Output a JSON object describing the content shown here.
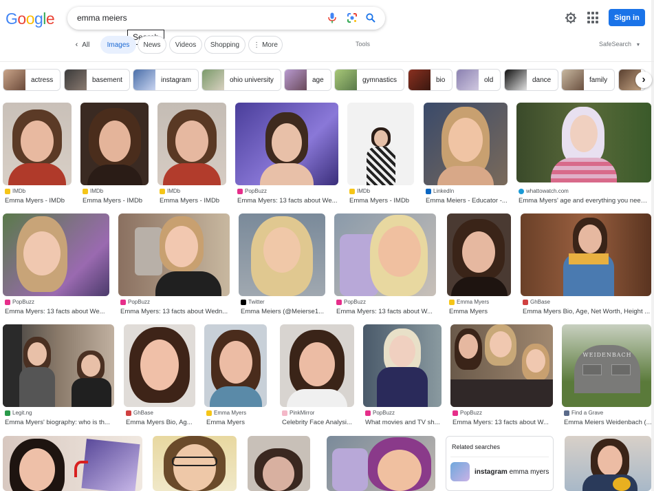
{
  "search": {
    "query": "emma meiers",
    "tooltip": "Search"
  },
  "header": {
    "logo_letters": [
      "G",
      "o",
      "o",
      "g",
      "l",
      "e"
    ],
    "logo_colors": [
      "#4285f4",
      "#ea4335",
      "#fbbc05",
      "#4285f4",
      "#34a853",
      "#ea4335"
    ],
    "sign_in": "Sign in"
  },
  "tabs": {
    "all": "All",
    "images": "Images",
    "news": "News",
    "videos": "Videos",
    "shopping": "Shopping",
    "more": "More",
    "tools": "Tools",
    "safesearch": "SafeSearch"
  },
  "chips": [
    "actress",
    "basement",
    "instagram",
    "ohio university",
    "age",
    "gymnastics",
    "bio",
    "old",
    "dance",
    "family"
  ],
  "results": [
    {
      "source": "IMDb",
      "title": "Emma Myers - IMDb"
    },
    {
      "source": "IMDb",
      "title": "Emma Myers - IMDb"
    },
    {
      "source": "IMDb",
      "title": "Emma Myers - IMDb"
    },
    {
      "source": "PopBuzz",
      "title": "Emma Myers: 13 facts about We..."
    },
    {
      "source": "IMDb",
      "title": "Emma Myers - IMDb"
    },
    {
      "source": "LinkedIn",
      "title": "Emma Meiers - Educator -..."
    },
    {
      "source": "whattowatch.com",
      "title": "Emma Myers' age and everything you need ..."
    },
    {
      "source": "PopBuzz",
      "title": "Emma Myers: 13 facts about We..."
    },
    {
      "source": "PopBuzz",
      "title": "Emma Myers: 13 facts about Wedn..."
    },
    {
      "source": "Twitter",
      "title": "Emma Meiers (@Meierse1..."
    },
    {
      "source": "PopBuzz",
      "title": "Emma Myers: 13 facts about W..."
    },
    {
      "source": "Emma Myers",
      "title": "Emma Myers"
    },
    {
      "source": "GhBase",
      "title": "Emma Myers Bio, Age, Net Worth, Height ..."
    },
    {
      "source": "Legit.ng",
      "title": "Emma Myers' biography: who is th..."
    },
    {
      "source": "GhBase",
      "title": "Emma Myers Bio, Ag..."
    },
    {
      "source": "Emma Myers",
      "title": "Emma Myers"
    },
    {
      "source": "PinkMirror",
      "title": "Celebrity Face Analysi..."
    },
    {
      "source": "PopBuzz",
      "title": "What movies and TV sh..."
    },
    {
      "source": "PopBuzz",
      "title": "Emma Myers: 13 facts about W..."
    },
    {
      "source": "Find a Grave",
      "title": "Emma Meiers Weidenbach (..."
    }
  ],
  "grave_text": "WEIDENBACH",
  "related": {
    "title": "Related searches",
    "item_bold": "instagram",
    "item_rest": " emma myers"
  }
}
